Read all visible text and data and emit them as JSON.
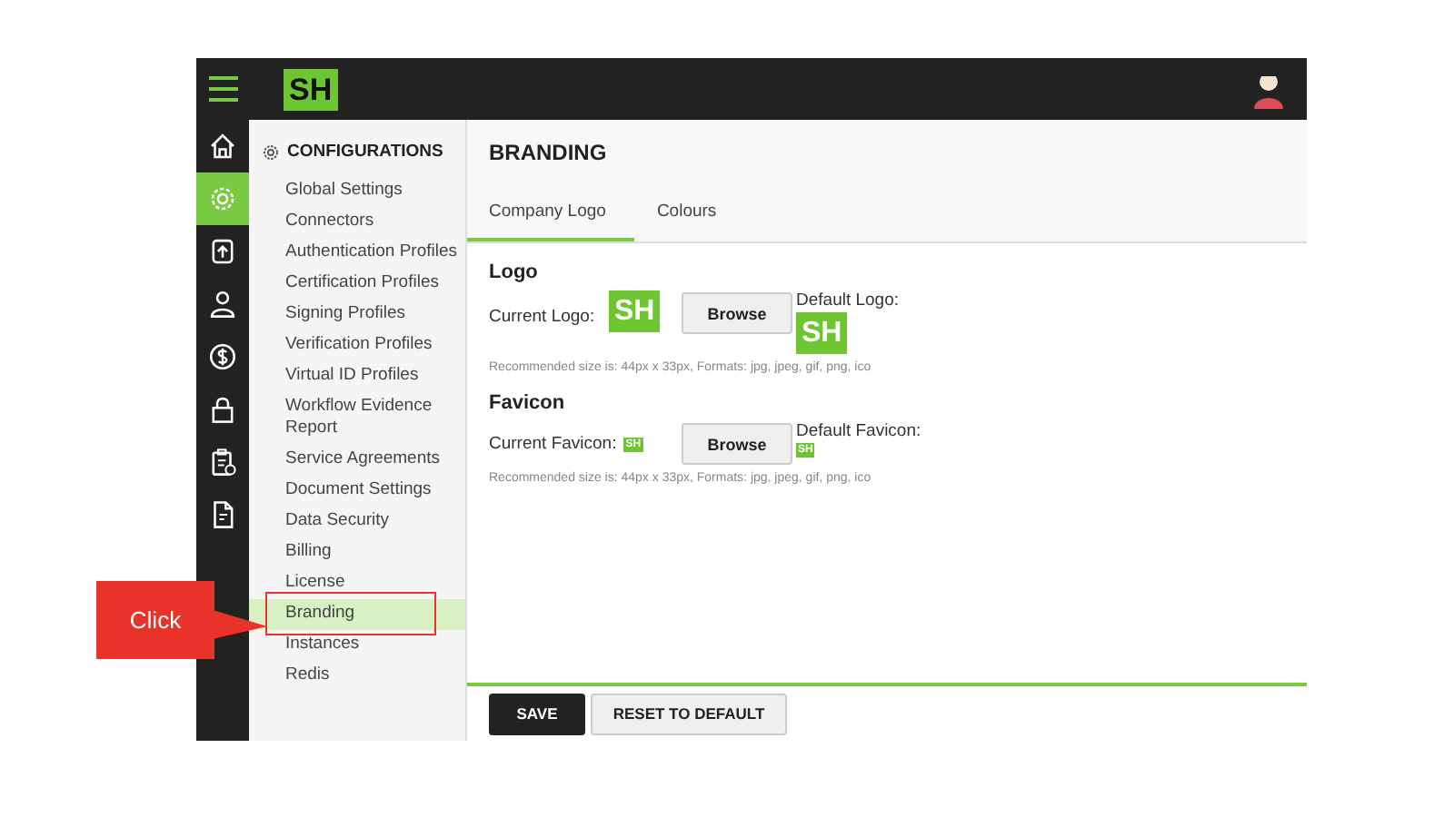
{
  "header": {
    "logo": "SH"
  },
  "rail": [
    {
      "kind": "home",
      "selected": false
    },
    {
      "kind": "gear",
      "selected": true
    },
    {
      "kind": "upload",
      "selected": false
    },
    {
      "kind": "person",
      "selected": false
    },
    {
      "kind": "dollar",
      "selected": false
    },
    {
      "kind": "lock",
      "selected": false
    },
    {
      "kind": "clipboard",
      "selected": false
    },
    {
      "kind": "document",
      "selected": false
    }
  ],
  "sidebar": {
    "title": "CONFIGURATIONS",
    "items": [
      {
        "label": "Global Settings",
        "selected": false
      },
      {
        "label": "Connectors",
        "selected": false
      },
      {
        "label": "Authentication Profiles",
        "selected": false
      },
      {
        "label": "Certification Profiles",
        "selected": false
      },
      {
        "label": "Signing Profiles",
        "selected": false
      },
      {
        "label": "Verification Profiles",
        "selected": false
      },
      {
        "label": "Virtual ID Profiles",
        "selected": false
      },
      {
        "label": "Workflow Evidence Report",
        "selected": false
      },
      {
        "label": "Service Agreements",
        "selected": false
      },
      {
        "label": "Document Settings",
        "selected": false
      },
      {
        "label": "Data Security",
        "selected": false
      },
      {
        "label": "Billing",
        "selected": false
      },
      {
        "label": "License",
        "selected": false
      },
      {
        "label": "Branding",
        "selected": true
      },
      {
        "label": "Instances",
        "selected": false
      },
      {
        "label": "Redis",
        "selected": false
      }
    ]
  },
  "page": {
    "title": "BRANDING",
    "tabs": [
      {
        "label": "Company Logo",
        "selected": true
      },
      {
        "label": "Colours",
        "selected": false
      }
    ],
    "sections": [
      {
        "kind": "logo",
        "heading": "Logo",
        "current_label": "Current Logo:",
        "current_logo": "SH",
        "button": "Browse",
        "default_label": "Default Logo:",
        "default_logo": "SH",
        "hint": "Recommended size is: 44px x 33px, Formats: jpg, jpeg, gif, png, ico"
      },
      {
        "kind": "favicon",
        "heading": "Favicon",
        "current_label": "Current Favicon:",
        "current_logo": "SH",
        "button": "Browse",
        "default_label": "Default Favicon:",
        "default_logo": "SH",
        "hint": "Recommended size is: 44px x 33px, Formats: jpg, jpeg, gif, png, ico"
      }
    ]
  },
  "footer": {
    "buttons": [
      {
        "label": "SAVE",
        "kind": "primary"
      },
      {
        "label": "RESET TO DEFAULT",
        "kind": "secondary"
      }
    ]
  },
  "callout": {
    "text": "Click"
  }
}
